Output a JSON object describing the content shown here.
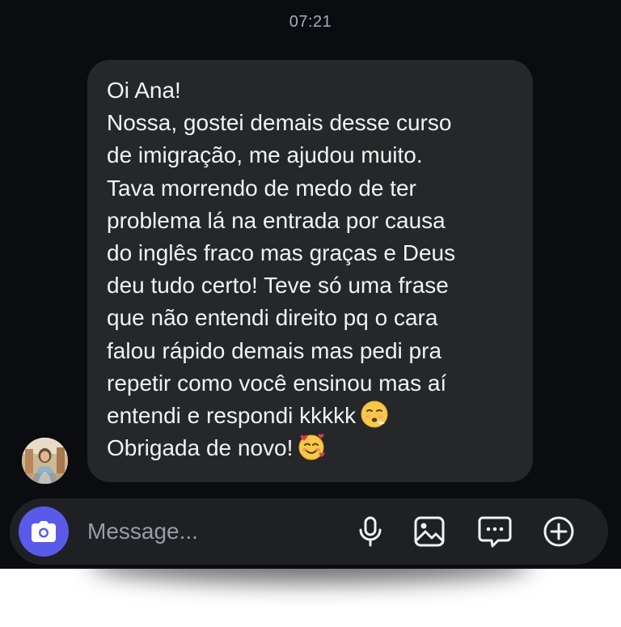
{
  "status": {
    "time": "07:21"
  },
  "message": {
    "lines": [
      "Oi Ana!",
      "Nossa, gostei demais desse curso",
      "de imigração, me ajudou muito.",
      "Tava morrendo de medo de ter",
      "problema lá na entrada por causa",
      "do inglês fraco mas graças e Deus",
      "deu tudo certo! Teve só uma frase",
      "que não entendi direito pq o cara",
      "falou rápido demais mas pedi pra",
      "repetir como você ensinou mas aí",
      "entendi e respondi kkkkk",
      "Obrigada de novo!"
    ],
    "emojis": {
      "line_11": "😮‍💨",
      "line_12": "🥰"
    }
  },
  "composer": {
    "placeholder": "Message...",
    "icons": [
      "camera-icon",
      "microphone-icon",
      "image-icon",
      "sticker-icon",
      "plus-icon"
    ]
  },
  "colors": {
    "background": "#0b0c10",
    "bubble": "#262729",
    "accent": "#5a5ae8",
    "text": "#f2f2f4",
    "muted": "#9b9ca3"
  }
}
